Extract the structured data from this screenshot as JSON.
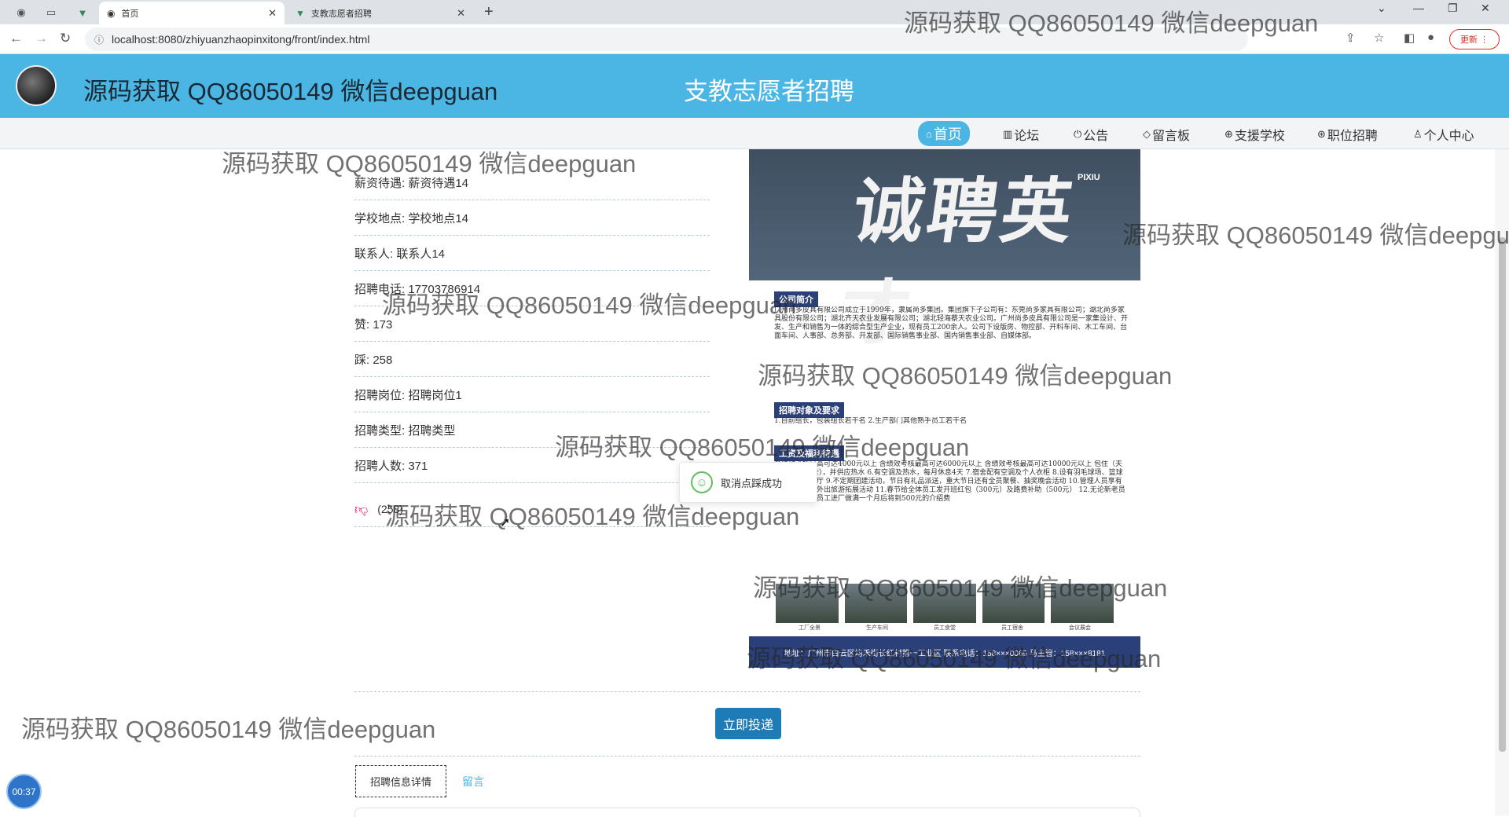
{
  "browser": {
    "tabs": [
      {
        "label": "首页",
        "active": true
      },
      {
        "label": "支教志愿者招聘",
        "active": false
      }
    ],
    "url": "localhost:8080/zhiyuanzhaopinxitong/front/index.html",
    "update_label": "更新"
  },
  "site": {
    "subtitle": "源码获取 QQ86050149 微信deepguan",
    "title": "支教志愿者招聘"
  },
  "nav": [
    {
      "label": "首页",
      "icon": "home-icon",
      "active": true
    },
    {
      "label": "论坛",
      "icon": "forum-icon"
    },
    {
      "label": "公告",
      "icon": "notice-icon"
    },
    {
      "label": "留言板",
      "icon": "tag-icon"
    },
    {
      "label": "支援学校",
      "icon": "globe-icon"
    },
    {
      "label": "职位招聘",
      "icon": "job-icon"
    },
    {
      "label": "个人中心",
      "icon": "user-icon"
    }
  ],
  "detail": {
    "salary": "薪资待遇: 薪资待遇14",
    "location": "学校地点: 学校地点14",
    "contact": "联系人: 联系人14",
    "phone": "招聘电话: 17703786914",
    "likes": "赞: 173",
    "dislikes": "踩: 258",
    "position": "招聘岗位: 招聘岗位1",
    "type": "招聘类型: 招聘类型",
    "count": "招聘人数: 371",
    "dislike_count": "(258)"
  },
  "poster": {
    "headline": "诚聘英才",
    "brand": "PIXIU",
    "section1_title": "公司简介",
    "section1_text": "广州尚多皮具有限公司成立于1999年，隶属尚多集团。集团旗下子公司有：东莞尚多家具有限公司；湖北尚多家具股份有限公司；湖北齐天农业发展有限公司；湖北轻海蔡天农业公司。广州尚多皮具有限公司是一家集设计、开发、生产和销售为一体的综合型生产企业，现有员工200余人。公司下设版房、物控部、开料车间、木工车间、台面车间、人事部、总务部、开发部、国际销售事业部、国内销售事业部、自媒体部。",
    "section2_title": "招聘对象及要求",
    "section2_text": "1.自前组长，包装组长若干名 2.生产部门其他熟手员工若干名",
    "section3_title": "工资及福利待遇",
    "section3_text": "含绩效考核最高可达4000元以上 含绩效考核最高可达6000元以上 含绩效考核最高可达10000元以上 包住（夫妻房/集体宿舍），并供应热水 6.有空调及热水，每月休息4天 7.宿舍配有空调及个人衣柜 8.设有羽毛球场、篮球场、公共电视厅 9.不定期团建活动，节日有礼品派送，重大节日还有全员聚餐、抽奖晚会活动 10.管理人员享有不定期聚餐及外出旅游拓展活动 11.春节给全体员工发开班红包（300元）及路费补助（500元） 12.无论新老员工介绍一名新员工进厂做满一个月后将到500元的介绍费",
    "photo_labels": [
      "工厂全景",
      "生产车间",
      "员工食堂",
      "员工宿舍",
      "会议展会"
    ],
    "footer": "地址：广州市白云区均禾街长红村第一工业区 联系电话：158×××0069 马主管：158×××8181"
  },
  "toast": {
    "text": "取消点踩成功"
  },
  "actions": {
    "apply_label": "立即投递"
  },
  "tabs": [
    {
      "label": "招聘信息详情",
      "active": true
    },
    {
      "label": "留言",
      "active": false
    }
  ],
  "timer": "00:37",
  "watermark": "源码获取 QQ86050149 微信deepguan",
  "colors": {
    "header_bg": "#4bb6e3",
    "apply_button": "#1f7bb5",
    "toast_success": "#5bc15b",
    "dislike": "#e11155"
  }
}
